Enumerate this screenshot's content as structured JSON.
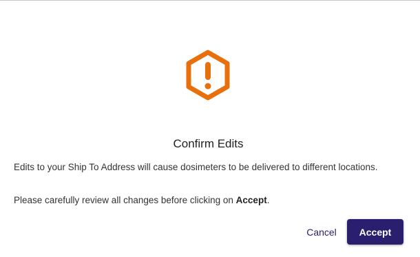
{
  "dialog": {
    "icon": "warning-hexagon-icon",
    "title": "Confirm Edits",
    "message_line1": "Edits to your Ship To Address will cause dosimeters to be delivered to different locations.",
    "message_line2_prefix": "Please carefully review all changes before clicking on ",
    "message_line2_emphasis": "Accept",
    "message_line2_suffix": ".",
    "cancel_label": "Cancel",
    "accept_label": "Accept"
  },
  "colors": {
    "icon": "#e8700c",
    "accept_background": "#2a1f6e",
    "cancel_text": "#2a2168"
  }
}
